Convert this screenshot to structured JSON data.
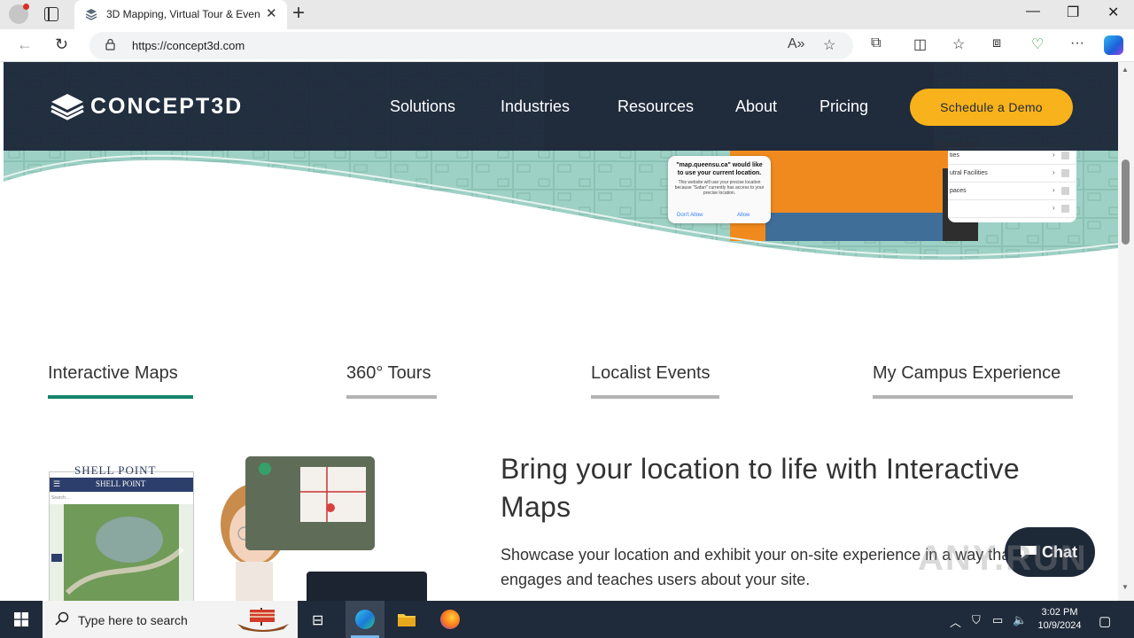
{
  "browser": {
    "tab_title": "3D Mapping, Virtual Tour & Even",
    "url": "https://concept3d.com",
    "icons": [
      "back-icon",
      "refresh-icon",
      "lock-icon",
      "read-aloud-icon",
      "favorite-icon",
      "extensions-icon",
      "split-screen-icon",
      "favorites-icon",
      "collections-icon",
      "browser-essentials-icon",
      "more-icon",
      "copilot-icon"
    ]
  },
  "site": {
    "logo_text": "CONCEPT3D",
    "nav": [
      "Solutions",
      "Industries",
      "Resources",
      "About",
      "Pricing"
    ],
    "cta": "Schedule a Demo",
    "header_color": "#1e293b",
    "accent": "#f8b21b"
  },
  "hero": {
    "popup_title": "\"map.queensu.ca\" would like to use your current location.",
    "popup_body": "This website will use your precise location because \"Safari\" currently has access to your precise location.",
    "popup_deny": "Don't Allow",
    "popup_allow": "Allow",
    "panel_rows": [
      "ties",
      "utral Facilities",
      "paces",
      ""
    ]
  },
  "tabs": [
    {
      "label": "Interactive Maps",
      "active": true
    },
    {
      "label": "360° Tours",
      "active": false
    },
    {
      "label": "Localist Events",
      "active": false
    },
    {
      "label": "My Campus Experience",
      "active": false
    }
  ],
  "feature": {
    "title": "Bring your location to life with Interactive Maps",
    "description": "Showcase your location and exhibit your on-site experience in a way that engages and teaches users about your site."
  },
  "preview": {
    "shell_point_logo": "SHELL POINT",
    "shell_point_bar": "SHELL POINT",
    "search_placeholder": "Search..."
  },
  "chat": {
    "label": "Chat"
  },
  "watermark": "ANY.RUN",
  "taskbar": {
    "search_placeholder": "Type here to search",
    "time": "3:02 PM",
    "date": "10/9/2024"
  }
}
